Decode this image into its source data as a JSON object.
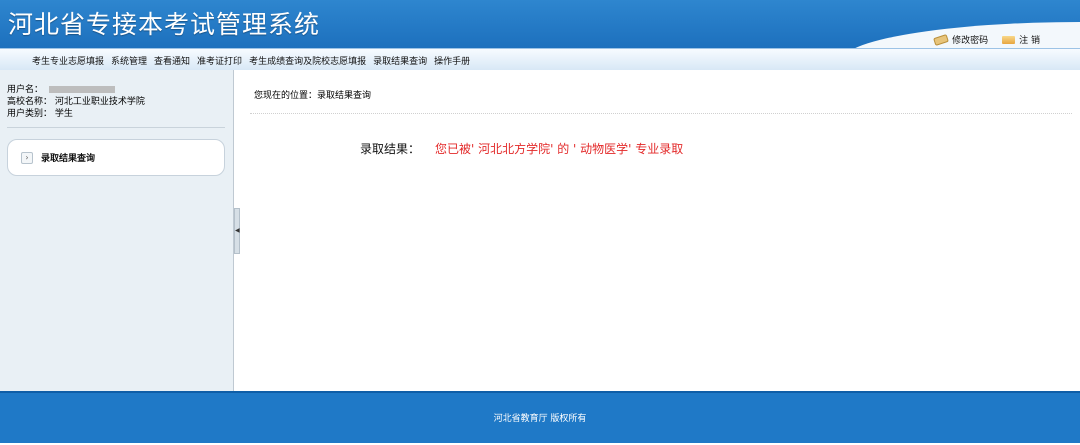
{
  "app": {
    "title": "河北省专接本考试管理系统"
  },
  "header_actions": {
    "change_password": "修改密码",
    "logout": "注  销"
  },
  "nav": {
    "items": [
      "考生专业志愿填报",
      "系统管理",
      "查看通知",
      "准考证打印",
      "考生成绩查询及院校志愿填报",
      "录取结果查询",
      "操作手册"
    ]
  },
  "sidebar": {
    "username_label": "用户名：",
    "school_label": "高校名称：",
    "school_value": "河北工业职业技术学院",
    "usertype_label": "用户类别：",
    "usertype_value": "学生",
    "menu_item": "录取结果查询"
  },
  "content": {
    "breadcrumb": "您现在的位置：录取结果查询",
    "result_label": "录取结果：",
    "result_text": "您已被' 河北北方学院'  的  ' 动物医学' 专业录取"
  },
  "footer": {
    "copyright": "河北省教育厅  版权所有"
  }
}
